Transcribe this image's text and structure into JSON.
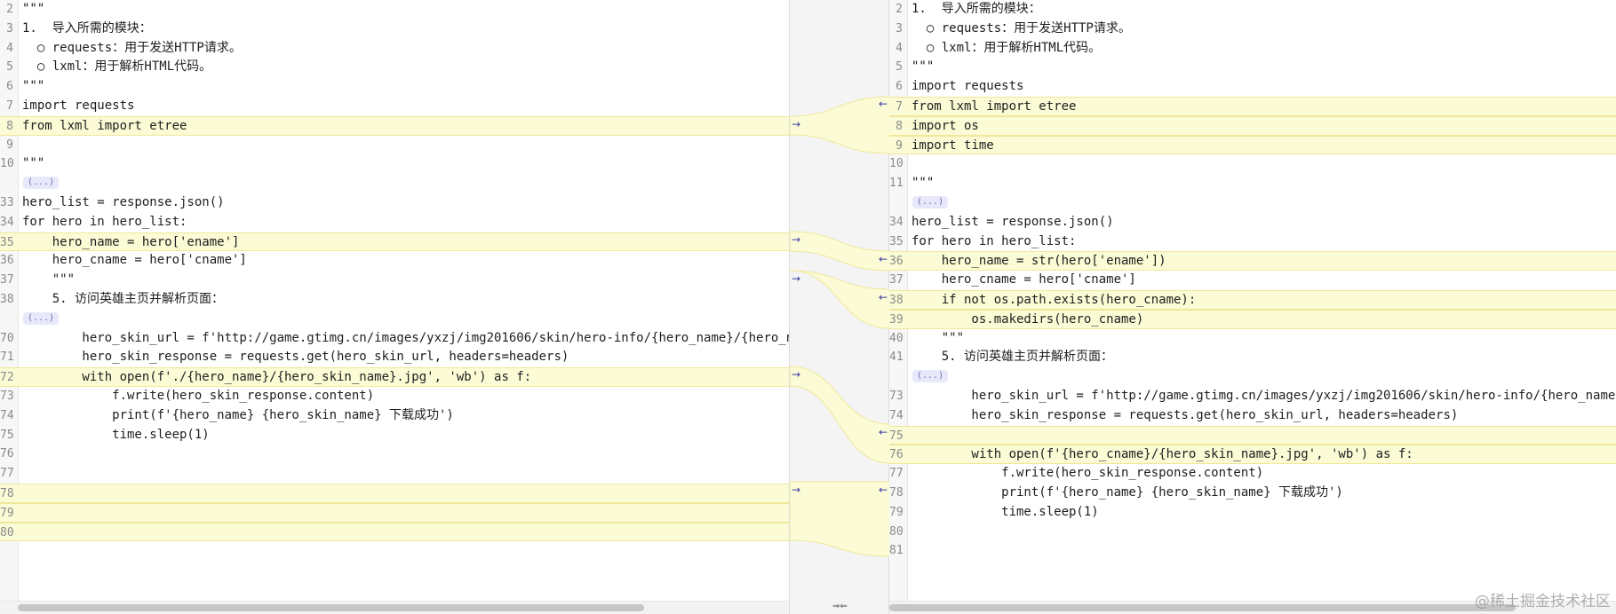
{
  "left": {
    "lines": [
      {
        "num": "2",
        "text": "\"\"\"",
        "changed": false
      },
      {
        "num": "3",
        "text": "1.  导入所需的模块：",
        "changed": false
      },
      {
        "num": "4",
        "text": "  ○ requests：用于发送HTTP请求。",
        "changed": false
      },
      {
        "num": "5",
        "text": "  ○ lxml：用于解析HTML代码。",
        "changed": false
      },
      {
        "num": "6",
        "text": "\"\"\"",
        "changed": false
      },
      {
        "num": "7",
        "text": "import requests",
        "changed": false
      },
      {
        "num": "8",
        "text": "from lxml import etree",
        "changed": true
      },
      {
        "num": "9",
        "text": "",
        "changed": false
      },
      {
        "num": "10",
        "text": "\"\"\"",
        "changed": false
      },
      {
        "num": "",
        "text": "",
        "fold": "(...)",
        "changed": false
      },
      {
        "num": "33",
        "text": "hero_list = response.json()",
        "changed": false
      },
      {
        "num": "34",
        "text": "for hero in hero_list:",
        "changed": false
      },
      {
        "num": "35",
        "text": "    hero_name = hero['ename']",
        "changed": true
      },
      {
        "num": "36",
        "text": "    hero_cname = hero['cname']",
        "changed": false
      },
      {
        "num": "37",
        "text": "    \"\"\"",
        "changed": false
      },
      {
        "num": "38",
        "text": "    5. 访问英雄主页并解析页面：",
        "changed": false
      },
      {
        "num": "",
        "text": "",
        "fold": "(...)",
        "changed": false
      },
      {
        "num": "70",
        "text": "        hero_skin_url = f'http://game.gtimg.cn/images/yxzj/img201606/skin/hero-info/{hero_name}/{hero_n",
        "changed": false
      },
      {
        "num": "71",
        "text": "        hero_skin_response = requests.get(hero_skin_url, headers=headers)",
        "changed": false
      },
      {
        "num": "72",
        "text": "        with open(f'./{hero_name}/{hero_skin_name}.jpg', 'wb') as f:",
        "changed": true
      },
      {
        "num": "73",
        "text": "            f.write(hero_skin_response.content)",
        "changed": false
      },
      {
        "num": "74",
        "text": "            print(f'{hero_name} {hero_skin_name} 下载成功')",
        "changed": false
      },
      {
        "num": "75",
        "text": "            time.sleep(1)",
        "changed": false
      },
      {
        "num": "76",
        "text": "",
        "changed": false
      },
      {
        "num": "77",
        "text": "",
        "changed": false
      },
      {
        "num": "78",
        "text": "",
        "changed": true
      },
      {
        "num": "79",
        "text": "",
        "changed": true
      },
      {
        "num": "80",
        "text": "",
        "changed": true
      }
    ]
  },
  "right": {
    "lines": [
      {
        "num": "2",
        "text": "1.  导入所需的模块：",
        "changed": false
      },
      {
        "num": "3",
        "text": "  ○ requests：用于发送HTTP请求。",
        "changed": false
      },
      {
        "num": "4",
        "text": "  ○ lxml：用于解析HTML代码。",
        "changed": false
      },
      {
        "num": "5",
        "text": "\"\"\"",
        "changed": false
      },
      {
        "num": "6",
        "text": "import requests",
        "changed": false
      },
      {
        "num": "7",
        "text": "from lxml import etree",
        "changed": true
      },
      {
        "num": "8",
        "text": "import os",
        "changed": true
      },
      {
        "num": "9",
        "text": "import time",
        "changed": true
      },
      {
        "num": "10",
        "text": "",
        "changed": false
      },
      {
        "num": "11",
        "text": "\"\"\"",
        "changed": false
      },
      {
        "num": "",
        "text": "",
        "fold": "(...)",
        "changed": false
      },
      {
        "num": "34",
        "text": "hero_list = response.json()",
        "changed": false
      },
      {
        "num": "35",
        "text": "for hero in hero_list:",
        "changed": false
      },
      {
        "num": "36",
        "text": "    hero_name = str(hero['ename'])",
        "changed": true
      },
      {
        "num": "37",
        "text": "    hero_cname = hero['cname']",
        "changed": false
      },
      {
        "num": "38",
        "text": "    if not os.path.exists(hero_cname):",
        "changed": true
      },
      {
        "num": "39",
        "text": "        os.makedirs(hero_cname)",
        "changed": true
      },
      {
        "num": "40",
        "text": "    \"\"\"",
        "changed": false
      },
      {
        "num": "41",
        "text": "    5. 访问英雄主页并解析页面：",
        "changed": false
      },
      {
        "num": "",
        "text": "",
        "fold": "(...)",
        "changed": false
      },
      {
        "num": "73",
        "text": "        hero_skin_url = f'http://game.gtimg.cn/images/yxzj/img201606/skin/hero-info/{hero_name",
        "changed": false
      },
      {
        "num": "74",
        "text": "        hero_skin_response = requests.get(hero_skin_url, headers=headers)",
        "changed": false
      },
      {
        "num": "75",
        "text": "",
        "changed": true
      },
      {
        "num": "76",
        "text": "        with open(f'{hero_cname}/{hero_skin_name}.jpg', 'wb') as f:",
        "changed": true
      },
      {
        "num": "77",
        "text": "            f.write(hero_skin_response.content)",
        "changed": false
      },
      {
        "num": "78",
        "text": "            print(f'{hero_name} {hero_skin_name} 下载成功')",
        "changed": false
      },
      {
        "num": "79",
        "text": "            time.sleep(1)",
        "changed": false
      },
      {
        "num": "80",
        "text": "",
        "changed": false
      },
      {
        "num": "81",
        "text": "",
        "changed": false
      }
    ]
  },
  "connector": {
    "swap_label": "⇒⇐",
    "left_arrow": "→",
    "right_arrow": "←"
  },
  "watermark": "@稀土掘金技术社区",
  "colors": {
    "changed_bg": "#fbfbd6",
    "changed_border": "#efe89a",
    "arrow": "#3a3aa8"
  }
}
